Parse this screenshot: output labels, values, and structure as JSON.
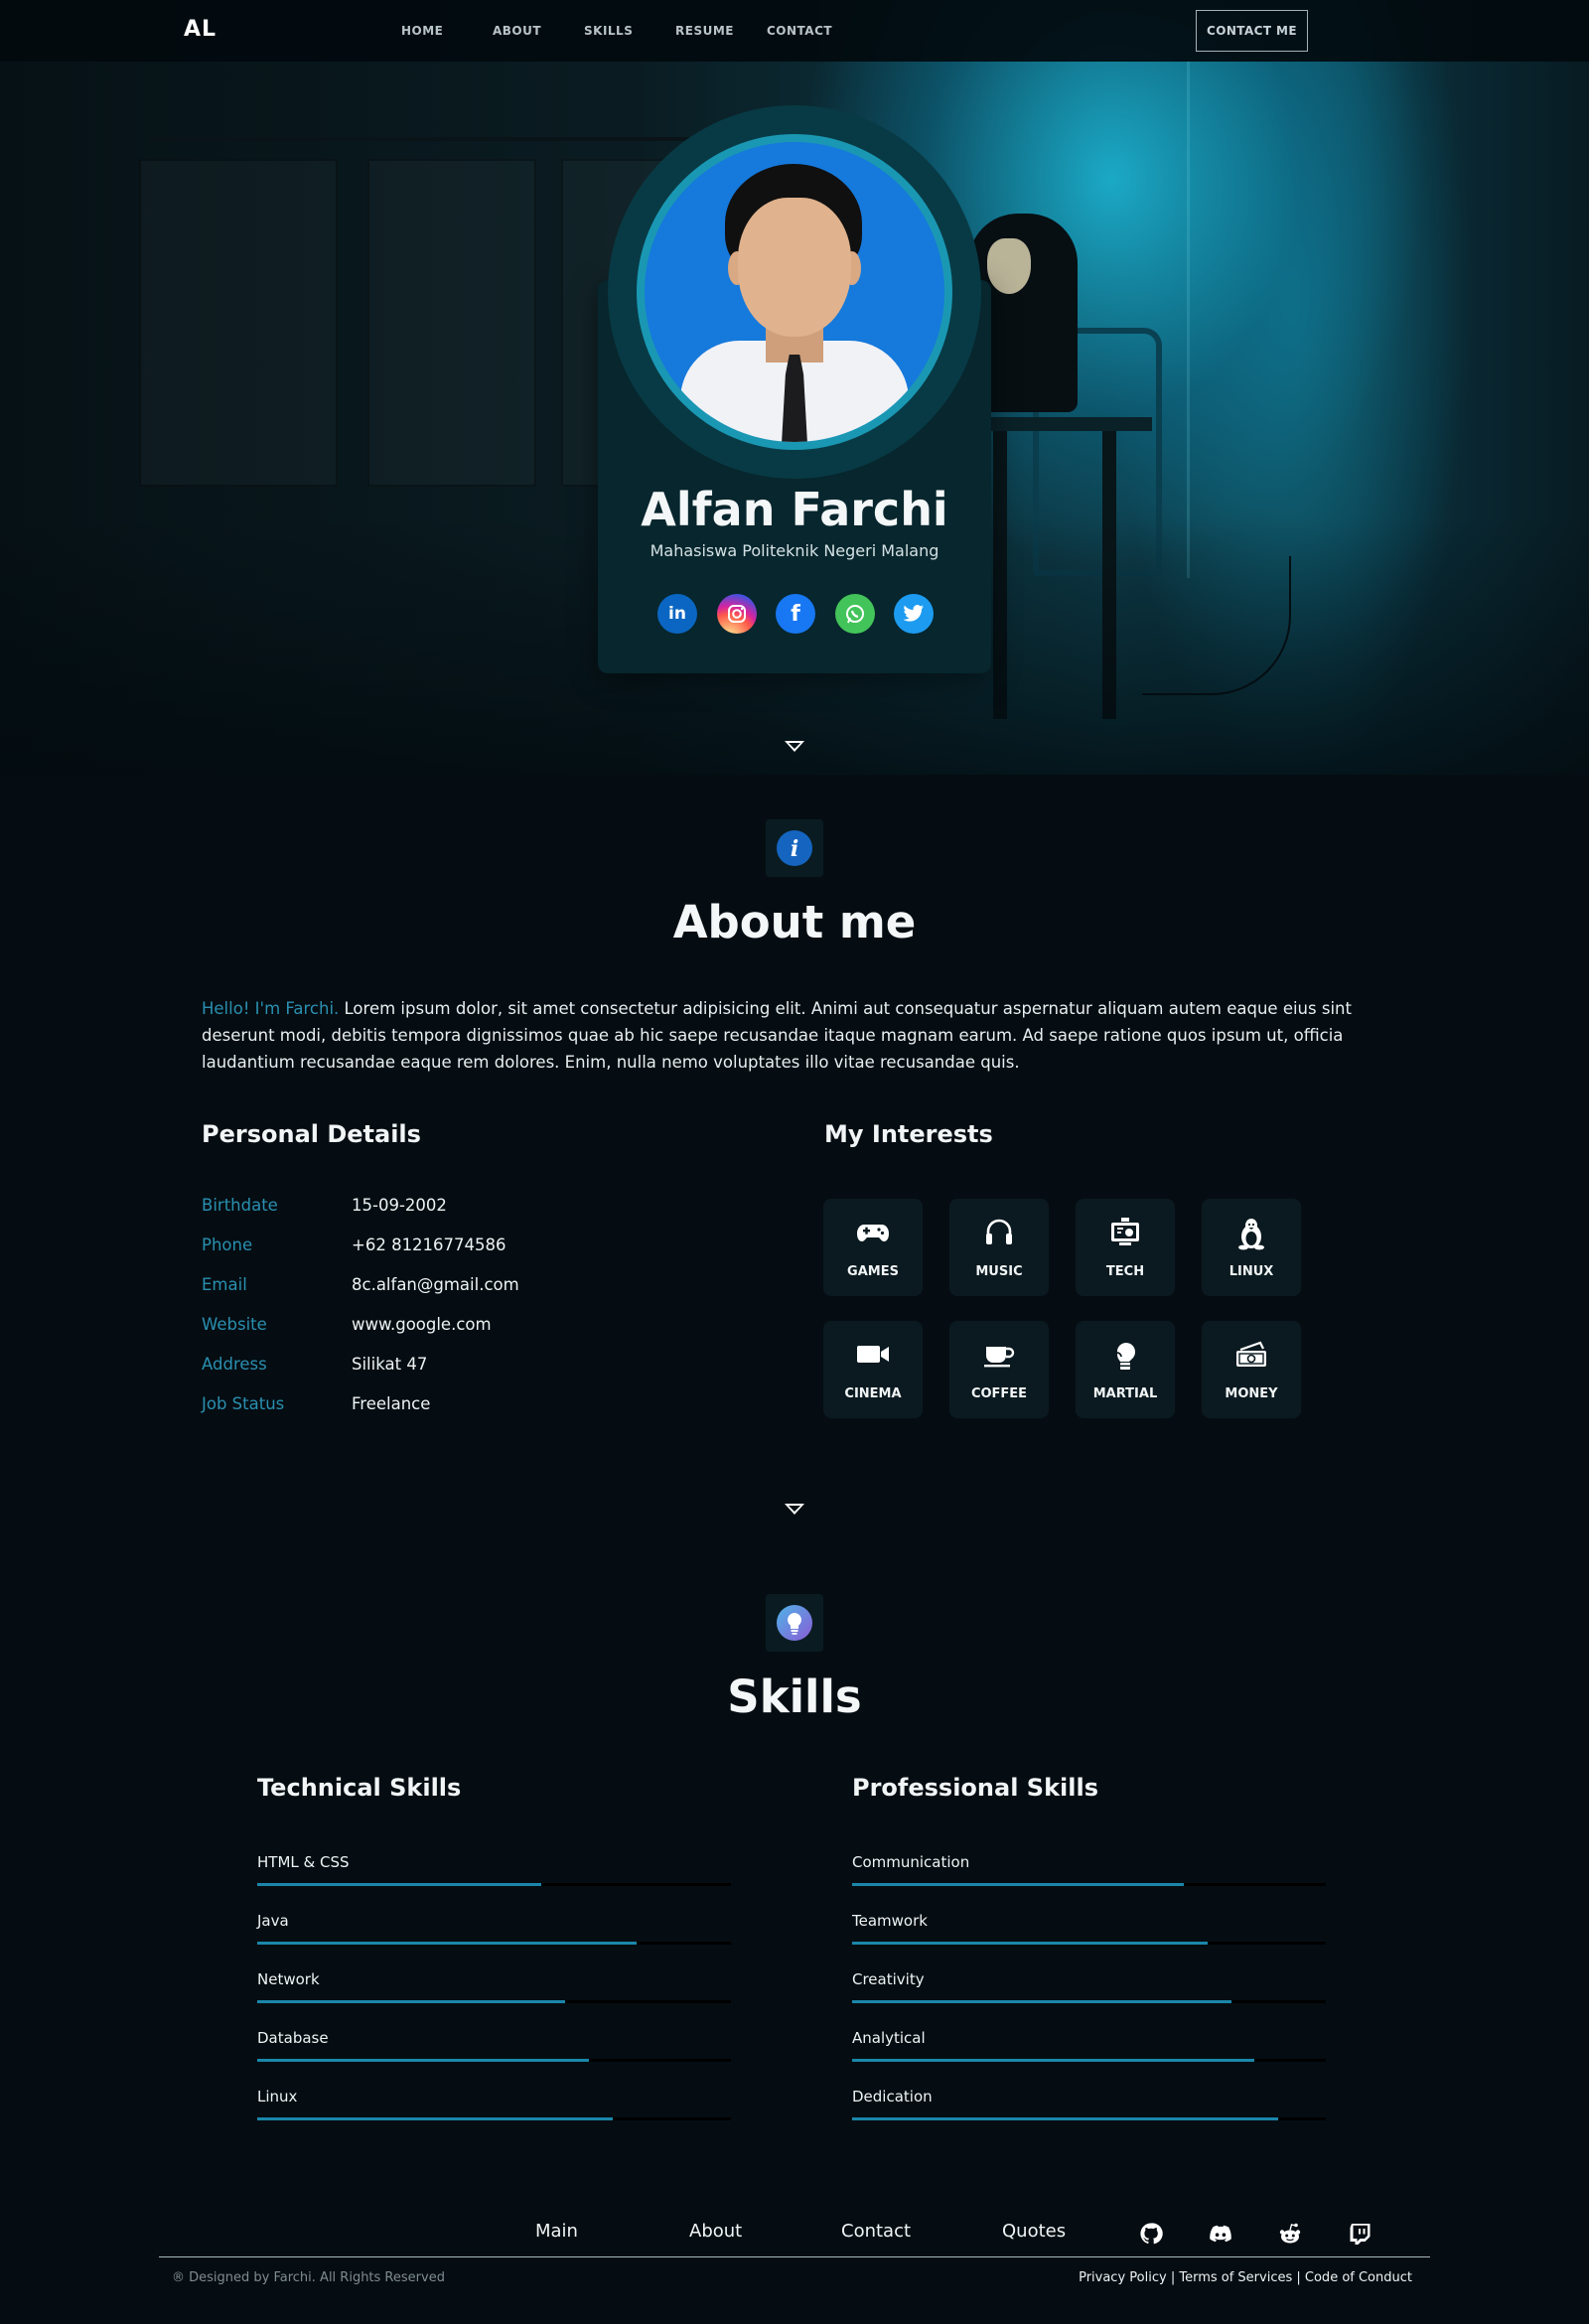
{
  "nav": {
    "logo": "AL",
    "links": [
      "HOME",
      "ABOUT",
      "SKILLS",
      "RESUME",
      "CONTACT"
    ],
    "cta": "CONTACT ME"
  },
  "hero": {
    "name": "Alfan Farchi",
    "subtitle": "Mahasiswa Politeknik Negeri Malang",
    "socials": [
      "linkedin-icon",
      "instagram-icon",
      "facebook-icon",
      "whatsapp-icon",
      "twitter-icon"
    ]
  },
  "about": {
    "icon": "info-icon",
    "title": "About me",
    "hello": "Hello! I'm Farchi.",
    "text": " Lorem ipsum dolor, sit amet consectetur adipisicing elit. Animi aut consequatur aspernatur aliquam autem eaque eius sint deserunt modi, debitis tempora dignissimos quae ab hic saepe recusandae itaque magnam earum. Ad saepe ratione quos ipsum ut, officia laudantium recusandae eaque rem dolores. Enim, nulla nemo voluptates illo vitae recusandae quis.",
    "details_title": "Personal Details",
    "details": [
      {
        "label": "Birthdate",
        "value": "15-09-2002"
      },
      {
        "label": "Phone",
        "value": "+62 81216774586"
      },
      {
        "label": "Email",
        "value": "8c.alfan@gmail.com"
      },
      {
        "label": "Website",
        "value": "www.google.com"
      },
      {
        "label": "Address",
        "value": "Silikat 47"
      },
      {
        "label": "Job Status",
        "value": "Freelance"
      }
    ],
    "interests_title": "My Interests",
    "interests": [
      {
        "label": "GAMES",
        "icon": "gamepad-icon"
      },
      {
        "label": "MUSIC",
        "icon": "headphones-icon"
      },
      {
        "label": "TECH",
        "icon": "tech-icon"
      },
      {
        "label": "LINUX",
        "icon": "linux-icon"
      },
      {
        "label": "CINEMA",
        "icon": "video-camera-icon"
      },
      {
        "label": "COFFEE",
        "icon": "coffee-icon"
      },
      {
        "label": "MARTIAL",
        "icon": "boxing-glove-icon"
      },
      {
        "label": "MONEY",
        "icon": "money-icon"
      }
    ]
  },
  "skills": {
    "icon": "lightbulb-icon",
    "title": "Skills",
    "technical_title": "Technical Skills",
    "technical": [
      {
        "name": "HTML & CSS",
        "level": 60
      },
      {
        "name": "Java",
        "level": 80
      },
      {
        "name": "Network",
        "level": 65
      },
      {
        "name": "Database",
        "level": 70
      },
      {
        "name": "Linux",
        "level": 75
      }
    ],
    "professional_title": "Professional Skills",
    "professional": [
      {
        "name": "Communication",
        "level": 70
      },
      {
        "name": "Teamwork",
        "level": 75
      },
      {
        "name": "Creativity",
        "level": 80
      },
      {
        "name": "Analytical",
        "level": 85
      },
      {
        "name": "Dedication",
        "level": 90
      }
    ]
  },
  "footer": {
    "links": [
      "Main",
      "About",
      "Contact",
      "Quotes"
    ],
    "icons": [
      "github-icon",
      "discord-icon",
      "reddit-icon",
      "twitch-icon"
    ],
    "copyright": "® Designed by Farchi. All Rights Reserved",
    "legal": [
      "Privacy Policy",
      "Terms of Services",
      "Code of Conduct"
    ]
  },
  "colors": {
    "accent": "#1b86aa",
    "label": "#2a8fb0",
    "background": "#050d12"
  }
}
